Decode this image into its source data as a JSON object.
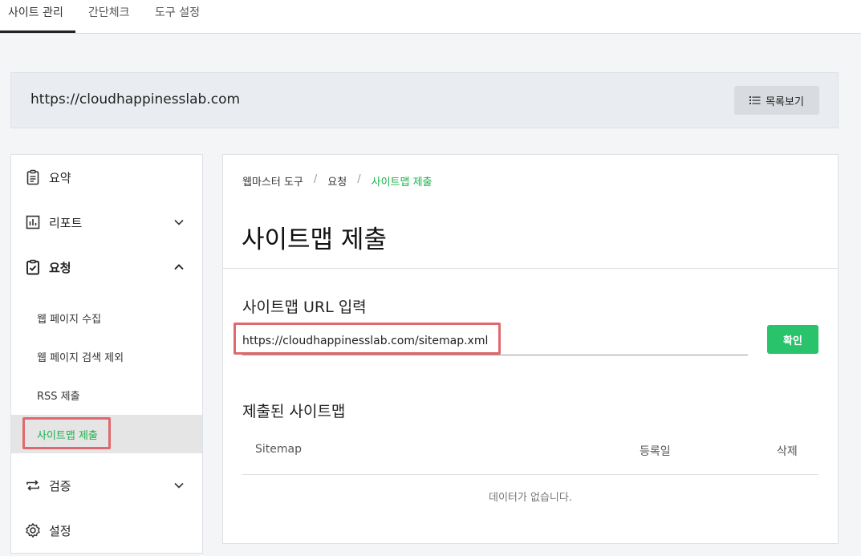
{
  "topnav": {
    "tabs": [
      {
        "label": "사이트 관리",
        "active": true
      },
      {
        "label": "간단체크",
        "active": false
      },
      {
        "label": "도구 설정",
        "active": false
      }
    ]
  },
  "site_bar": {
    "url": "https://cloudhappinesslab.com",
    "list_button": "목록보기"
  },
  "sidebar": {
    "items": [
      {
        "label": "요약",
        "icon": "clipboard-icon"
      },
      {
        "label": "리포트",
        "icon": "bar-chart-icon"
      },
      {
        "label": "요청",
        "icon": "clipboard-check-icon"
      },
      {
        "label": "검증",
        "icon": "repeat-arrows-icon"
      },
      {
        "label": "설정",
        "icon": "gear-icon"
      }
    ],
    "sub_items": [
      {
        "label": "웹 페이지 수집"
      },
      {
        "label": "웹 페이지 검색 제외"
      },
      {
        "label": "RSS 제출"
      },
      {
        "label": "사이트맵 제출",
        "active": true
      }
    ]
  },
  "main": {
    "breadcrumb": [
      "웹마스터 도구",
      "요청",
      "사이트맵 제출"
    ],
    "page_title": "사이트맵 제출",
    "input_section_title": "사이트맵 URL 입력",
    "url_input_value": "https://cloudhappinesslab.com/sitemap.xml",
    "confirm_button": "확인",
    "submitted_title": "제출된 사이트맵",
    "table_headers": [
      "Sitemap",
      "등록일",
      "삭제"
    ],
    "empty_message": "데이터가 없습니다."
  },
  "colors": {
    "accent_green": "#16b44a",
    "button_green": "#28c36a",
    "highlight_red": "#e0696d"
  }
}
